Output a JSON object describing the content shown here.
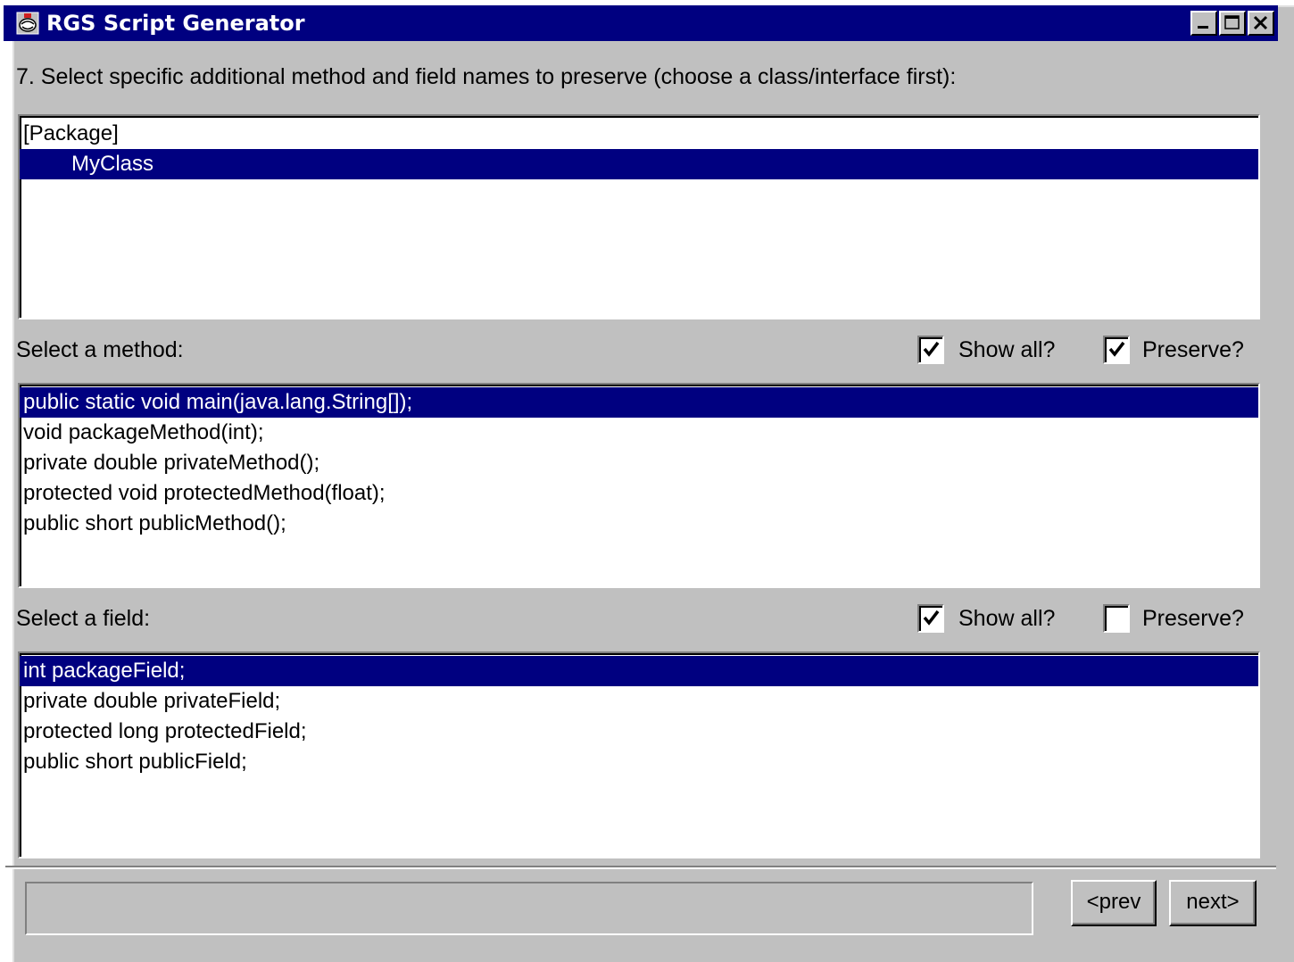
{
  "window": {
    "title": "RGS Script Generator"
  },
  "step_label": "7. Select specific additional method and field names to preserve (choose a class/interface first):",
  "classes": {
    "items": [
      {
        "label": "[Package]",
        "selected": false,
        "indent": false
      },
      {
        "label": "MyClass",
        "selected": true,
        "indent": true
      }
    ]
  },
  "methods": {
    "label": "Select a method:",
    "show_all": {
      "label": "Show all?",
      "checked": true
    },
    "preserve": {
      "label": "Preserve?",
      "checked": true
    },
    "items": [
      {
        "label": "public static void main(java.lang.String[]);",
        "selected": true
      },
      {
        "label": "void packageMethod(int);",
        "selected": false
      },
      {
        "label": "private double privateMethod();",
        "selected": false
      },
      {
        "label": "protected void protectedMethod(float);",
        "selected": false
      },
      {
        "label": "public short publicMethod();",
        "selected": false
      }
    ]
  },
  "fields": {
    "label": "Select a field:",
    "show_all": {
      "label": "Show all?",
      "checked": true
    },
    "preserve": {
      "label": "Preserve?",
      "checked": false
    },
    "items": [
      {
        "label": "int packageField;",
        "selected": true
      },
      {
        "label": "private double privateField;",
        "selected": false
      },
      {
        "label": "protected long protectedField;",
        "selected": false
      },
      {
        "label": "public short publicField;",
        "selected": false
      }
    ]
  },
  "status": {
    "text": ""
  },
  "nav": {
    "prev_label": "<prev",
    "next_label": "next>"
  },
  "colors": {
    "selection": "#000080",
    "face": "#c0c0c0"
  }
}
